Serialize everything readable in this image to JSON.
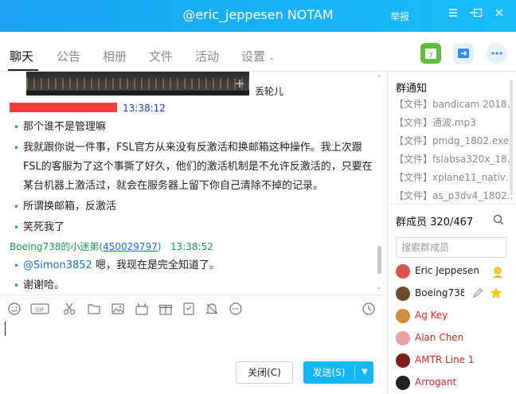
{
  "window": {
    "title": "@eric_jeppesen NOTAM",
    "report": "举报"
  },
  "tabs": [
    {
      "label": "聊天"
    },
    {
      "label": "公告"
    },
    {
      "label": "相册"
    },
    {
      "label": "文件"
    },
    {
      "label": "活动"
    },
    {
      "label": "设置"
    }
  ],
  "chat": {
    "image_caption_side": "丢轮儿",
    "timestamp1": "13:38:12",
    "messages1": [
      "那个谁不是管理嘛",
      "我就跟你说一件事，FSL官方从来没有反激活和换邮箱这种操作。我上次跟FSL的客服为了这个事撕了好久，他们的激活机制是不允许反激活的，只要在某台机器上激活过，就会在服务器上留下你自己清除不掉的记录。",
      "所谓换邮箱，反激活",
      "笑死我了"
    ],
    "sender2": {
      "name": "Boeing738的小迷弟(",
      "uid": "450029797",
      "close": ")",
      "time": "13:38:52"
    },
    "messages2": [
      {
        "mention": "@Simon3852",
        "text": " 嗯，我现在是完全知道了。"
      },
      {
        "mention": "",
        "text": "谢谢哈。"
      }
    ]
  },
  "composer": {
    "close_label": "关闭(C)",
    "send_label": "发送(S)"
  },
  "sidebar": {
    "notice_title": "群通知",
    "notices": [
      "【文件】bandicam 2018…",
      "【文件】通波.mp3",
      "【文件】pmdg_1802.exe",
      "【文件】fslabsa320x_18…",
      "【文件】xplane11_nativ…",
      "【文件】as_p3dv4_1802…"
    ],
    "members_title": "群成员 320/467",
    "search_placeholder": "搜索群成员",
    "members": [
      {
        "name": "Eric Jeppesen",
        "red": false,
        "avatar": "#d9534f"
      },
      {
        "name": "Boeing738",
        "red": false,
        "avatar": "#6b4a2e"
      },
      {
        "name": "Ag Key",
        "red": true,
        "avatar": "#d38a3a"
      },
      {
        "name": "Alan Chen",
        "red": true,
        "avatar": "#e8a0a0"
      },
      {
        "name": "AMTR Line 1",
        "red": true,
        "avatar": "#7a1e1e"
      },
      {
        "name": "Arrogant",
        "red": true,
        "avatar": "#222222"
      }
    ]
  }
}
